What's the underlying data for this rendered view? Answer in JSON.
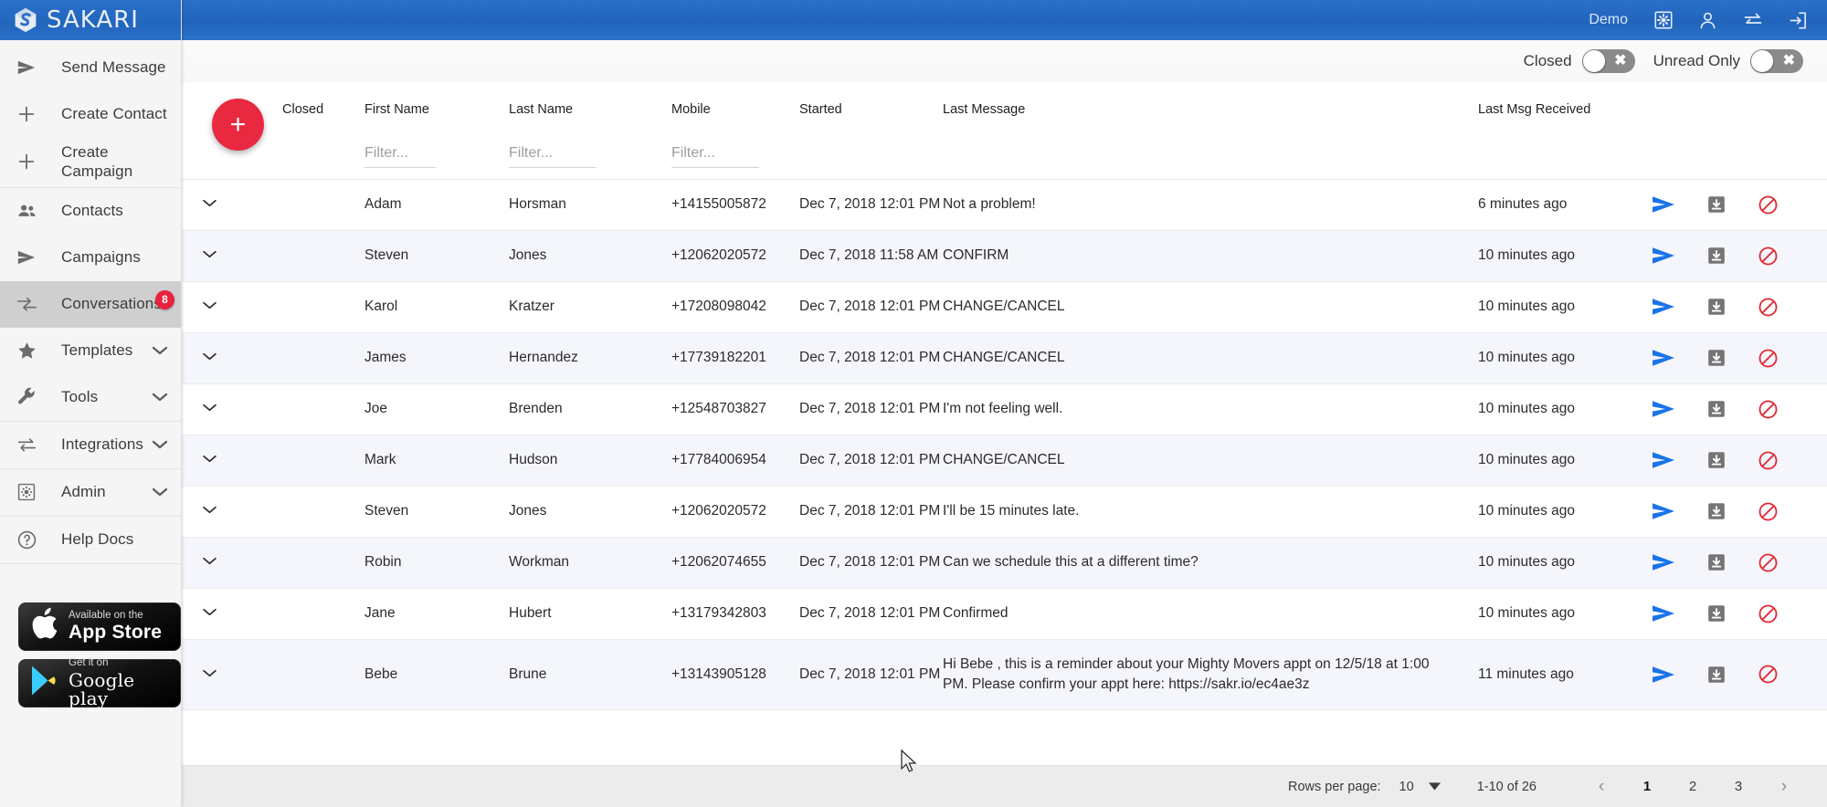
{
  "brand": {
    "name": "SAKARI",
    "logo_icon": "sakari-logo-icon"
  },
  "sidebar": {
    "groups": [
      {
        "items": [
          {
            "label": "Send Message",
            "icon": "send-icon",
            "chevron": false
          },
          {
            "label": "Create Contact",
            "icon": "plus-icon",
            "chevron": false
          },
          {
            "label": "Create Campaign",
            "icon": "plus-icon",
            "chevron": false
          }
        ]
      },
      {
        "items": [
          {
            "label": "Contacts",
            "icon": "people-icon",
            "chevron": false
          },
          {
            "label": "Campaigns",
            "icon": "send-icon",
            "chevron": false
          },
          {
            "label": "Conversations",
            "icon": "conversations-icon",
            "chevron": false,
            "active": true,
            "badge": "8"
          },
          {
            "label": "Templates",
            "icon": "star-icon",
            "chevron": true
          },
          {
            "label": "Tools",
            "icon": "wrench-icon",
            "chevron": true
          }
        ]
      },
      {
        "items": [
          {
            "label": "Integrations",
            "icon": "integrations-icon",
            "chevron": true
          }
        ]
      },
      {
        "items": [
          {
            "label": "Admin",
            "icon": "admin-gear-icon",
            "chevron": true
          }
        ]
      },
      {
        "items": [
          {
            "label": "Help Docs",
            "icon": "help-circle-icon",
            "chevron": false
          }
        ]
      }
    ],
    "store_badges": [
      {
        "small": "Available on the",
        "big": "App Store",
        "icon": "apple-icon"
      },
      {
        "small": "Get it on",
        "big": "Google play",
        "icon": "google-play-icon"
      }
    ]
  },
  "topbar": {
    "account": "Demo",
    "icons": [
      {
        "name": "settings-gear-icon"
      },
      {
        "name": "person-icon"
      },
      {
        "name": "switch-account-icon"
      },
      {
        "name": "logout-icon"
      }
    ]
  },
  "filters": {
    "closed": {
      "label": "Closed",
      "on": false
    },
    "unread_only": {
      "label": "Unread Only",
      "on": false
    }
  },
  "fab": {
    "label": "+",
    "color": "#e8293f",
    "name": "new-conversation-button"
  },
  "table": {
    "columns": [
      {
        "key": "expand",
        "label": ""
      },
      {
        "key": "closed",
        "label": "Closed"
      },
      {
        "key": "first_name",
        "label": "First Name"
      },
      {
        "key": "last_name",
        "label": "Last Name"
      },
      {
        "key": "mobile",
        "label": "Mobile"
      },
      {
        "key": "started",
        "label": "Started"
      },
      {
        "key": "last_message",
        "label": "Last Message"
      },
      {
        "key": "last_msg_received",
        "label": "Last Msg Received"
      },
      {
        "key": "actions",
        "label": ""
      }
    ],
    "filter_placeholder": "Filter...",
    "row_actions": [
      {
        "name": "send-message-icon",
        "color": "#1a73e8"
      },
      {
        "name": "archive-icon",
        "color": "#757575"
      },
      {
        "name": "block-icon",
        "color": "#e02a35"
      }
    ],
    "rows": [
      {
        "first_name": "Adam",
        "last_name": "Horsman",
        "mobile": "+14155005872",
        "started": "Dec 7, 2018 12:01 PM",
        "last_message": "Not a problem!",
        "last_msg_received": "6 minutes ago"
      },
      {
        "first_name": "Steven",
        "last_name": "Jones",
        "mobile": "+12062020572",
        "started": "Dec 7, 2018 11:58 AM",
        "last_message": "CONFIRM",
        "last_msg_received": "10 minutes ago"
      },
      {
        "first_name": "Karol",
        "last_name": "Kratzer",
        "mobile": "+17208098042",
        "started": "Dec 7, 2018 12:01 PM",
        "last_message": "CHANGE/CANCEL",
        "last_msg_received": "10 minutes ago"
      },
      {
        "first_name": "James",
        "last_name": "Hernandez",
        "mobile": "+17739182201",
        "started": "Dec 7, 2018 12:01 PM",
        "last_message": "CHANGE/CANCEL",
        "last_msg_received": "10 minutes ago"
      },
      {
        "first_name": "Joe",
        "last_name": "Brenden",
        "mobile": "+12548703827",
        "started": "Dec 7, 2018 12:01 PM",
        "last_message": "I'm not feeling well.",
        "last_msg_received": "10 minutes ago"
      },
      {
        "first_name": "Mark",
        "last_name": "Hudson",
        "mobile": "+17784006954",
        "started": "Dec 7, 2018 12:01 PM",
        "last_message": "CHANGE/CANCEL",
        "last_msg_received": "10 minutes ago"
      },
      {
        "first_name": "Steven",
        "last_name": "Jones",
        "mobile": "+12062020572",
        "started": "Dec 7, 2018 12:01 PM",
        "last_message": "I'll be 15 minutes late.",
        "last_msg_received": "10 minutes ago"
      },
      {
        "first_name": "Robin",
        "last_name": "Workman",
        "mobile": "+12062074655",
        "started": "Dec 7, 2018 12:01 PM",
        "last_message": "Can we schedule this at a different time?",
        "last_msg_received": "10 minutes ago"
      },
      {
        "first_name": "Jane",
        "last_name": "Hubert",
        "mobile": "+13179342803",
        "started": "Dec 7, 2018 12:01 PM",
        "last_message": "Confirmed",
        "last_msg_received": "10 minutes ago"
      },
      {
        "first_name": "Bebe",
        "last_name": "Brune",
        "mobile": "+13143905128",
        "started": "Dec 7, 2018 12:01 PM",
        "last_message": "Hi Bebe , this is a reminder about your Mighty Movers appt on 12/5/18 at 1:00 PM. Please confirm your appt here: https://sakr.io/ec4ae3z",
        "last_msg_received": "11 minutes ago"
      }
    ]
  },
  "paginator": {
    "rows_per_page_label": "Rows per page:",
    "rows_per_page_value": "10",
    "range": "1-10 of 26",
    "pages": [
      "1",
      "2",
      "3"
    ],
    "active_page": "1",
    "prev_icon": "chevron-left-icon",
    "next_icon": "chevron-right-icon"
  }
}
